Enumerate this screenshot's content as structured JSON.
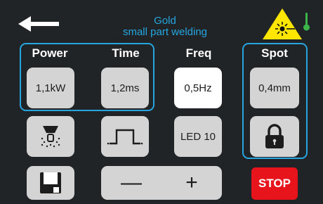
{
  "header": {
    "title_line1": "Gold",
    "title_line2": "small part welding",
    "back_icon": "arrow-left-icon",
    "laser_warning_icon": "laser-warning-icon",
    "status_icon": "thermometer-icon"
  },
  "params": {
    "power_label": "Power",
    "time_label": "Time",
    "freq_label": "Freq",
    "spot_label": "Spot",
    "power_value": "1,1kW",
    "time_value": "1,2ms",
    "freq_value": "0,5Hz",
    "spot_value": "0,4mm"
  },
  "controls": {
    "led_label": "LED 10",
    "minus_label": "—",
    "plus_label": "+",
    "stop_label": "STOP",
    "gas_icon": "gas-nozzle-icon",
    "pulse_icon": "pulse-shape-icon",
    "lock_icon": "lock-icon",
    "save_icon": "save-icon"
  },
  "colors": {
    "background": "#202426",
    "accent": "#26a6e0",
    "button": "#d4d4d4",
    "stop": "#e8141c",
    "warning": "#ffe600",
    "status_green": "#3bb54a"
  }
}
